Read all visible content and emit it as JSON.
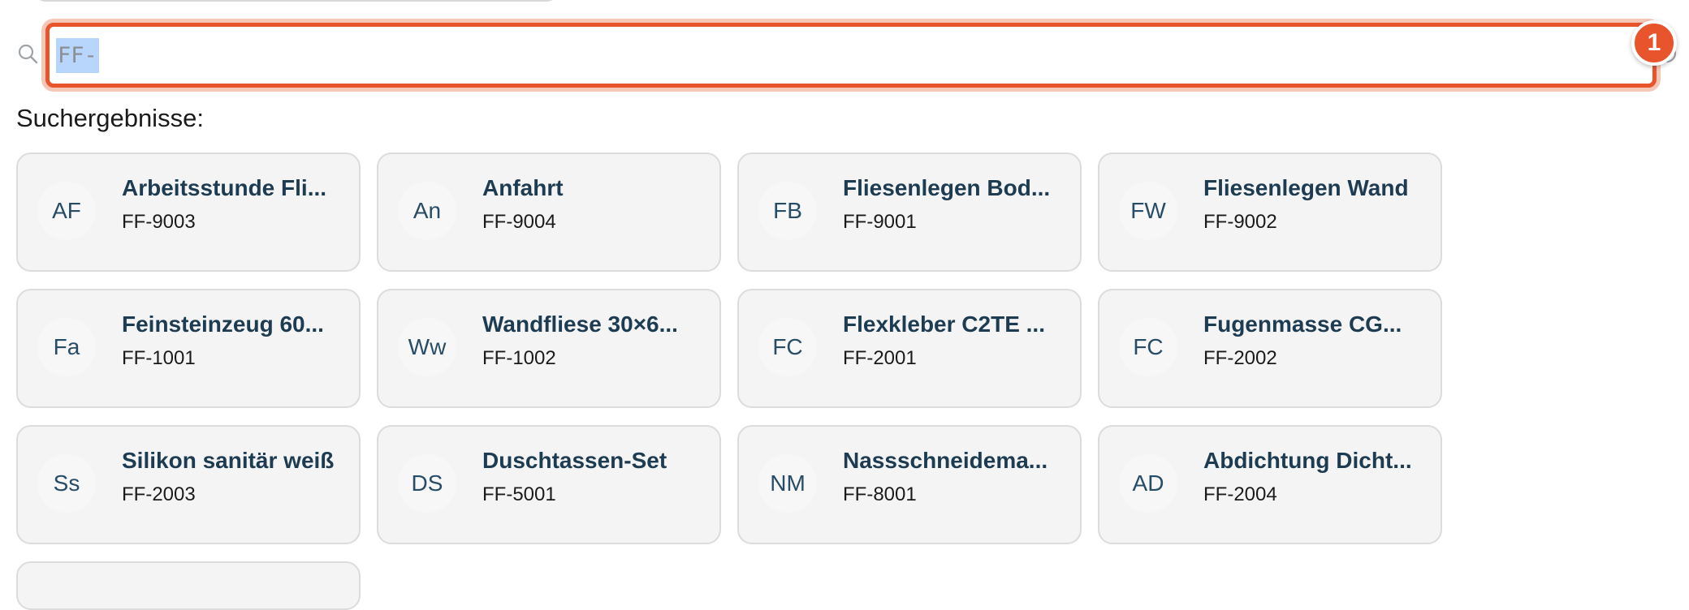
{
  "search": {
    "value": "FF-",
    "marker": "1"
  },
  "results": {
    "label": "Suchergebnisse:",
    "items": [
      {
        "initials": "AF",
        "title": "Arbeitsstunde Fli...",
        "code": "FF-9003"
      },
      {
        "initials": "An",
        "title": "Anfahrt",
        "code": "FF-9004"
      },
      {
        "initials": "FB",
        "title": "Fliesenlegen Bod...",
        "code": "FF-9001"
      },
      {
        "initials": "FW",
        "title": "Fliesenlegen Wand",
        "code": "FF-9002"
      },
      {
        "initials": "Fa",
        "title": "Feinsteinzeug 60...",
        "code": "FF-1001"
      },
      {
        "initials": "Ww",
        "title": "Wandfliese 30×6...",
        "code": "FF-1002"
      },
      {
        "initials": "FC",
        "title": "Flexkleber C2TE ...",
        "code": "FF-2001"
      },
      {
        "initials": "FC",
        "title": "Fugenmasse CG...",
        "code": "FF-2002"
      },
      {
        "initials": "Ss",
        "title": "Silikon sanitär weiß",
        "code": "FF-2003"
      },
      {
        "initials": "DS",
        "title": "Duschtassen-Set",
        "code": "FF-5001"
      },
      {
        "initials": "NM",
        "title": "Nassschneidema...",
        "code": "FF-8001"
      },
      {
        "initials": "AD",
        "title": "Abdichtung Dicht...",
        "code": "FF-2004"
      }
    ]
  },
  "colors": {
    "accent": "#e8552d",
    "selection": "#b8d5fb",
    "title_text": "#1d3c52",
    "card_bg": "#f4f4f4"
  },
  "icons": {
    "search": "search-icon",
    "clear": "clear-icon"
  }
}
